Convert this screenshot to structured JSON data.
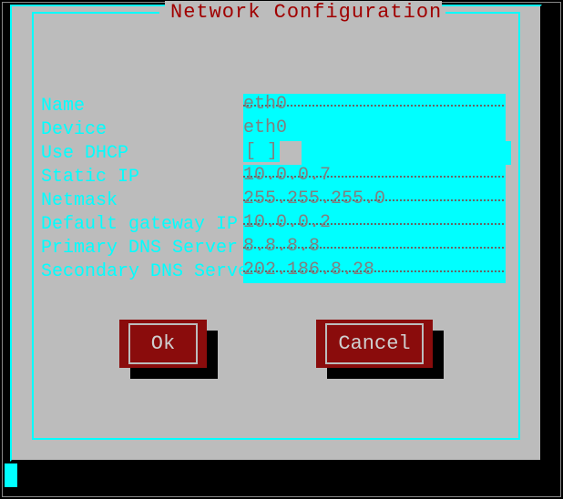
{
  "title": "Network Configuration",
  "fields": {
    "name": {
      "label": "Name",
      "value": "eth0"
    },
    "device": {
      "label": "Device",
      "value": "eth0"
    },
    "dhcp": {
      "label": "Use DHCP",
      "checked_display": "[ ]"
    },
    "ip": {
      "label": "Static IP",
      "value": "10.0.0.7"
    },
    "mask": {
      "label": "Netmask",
      "value": "255.255.255.0"
    },
    "gw": {
      "label": "Default gateway IP",
      "value": "10.0.0.2"
    },
    "dns1": {
      "label": "Primary DNS Server",
      "value": "8.8.8.8"
    },
    "dns2": {
      "label": "Secondary DNS Server",
      "value": "202.186.8.28"
    }
  },
  "buttons": {
    "ok": "Ok",
    "cancel": "Cancel"
  }
}
